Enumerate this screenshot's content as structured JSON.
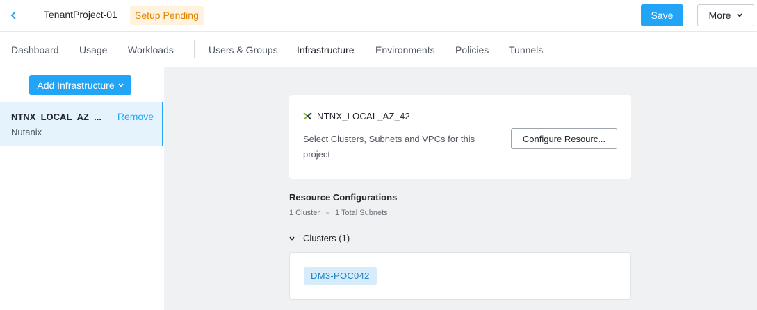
{
  "header": {
    "project_name": "TenantProject-01",
    "status_badge": "Setup Pending",
    "save_label": "Save",
    "more_label": "More"
  },
  "tabs": [
    {
      "label": "Dashboard",
      "active": false
    },
    {
      "label": "Usage",
      "active": false
    },
    {
      "label": "Workloads",
      "active": false
    },
    {
      "label": "Users & Groups",
      "active": false
    },
    {
      "label": "Infrastructure",
      "active": true
    },
    {
      "label": "Environments",
      "active": false
    },
    {
      "label": "Policies",
      "active": false
    },
    {
      "label": "Tunnels",
      "active": false
    }
  ],
  "sidebar": {
    "add_button_label": "Add Infrastructure",
    "items": [
      {
        "name": "NTNX_LOCAL_AZ_...",
        "remove_label": "Remove",
        "type": "Nutanix"
      }
    ]
  },
  "main": {
    "account_card": {
      "icon": "nutanix-logo-icon",
      "title": "NTNX_LOCAL_AZ_42",
      "description": "Select Clusters, Subnets and VPCs for this project",
      "configure_label": "Configure Resourc..."
    },
    "resource_configurations": {
      "title": "Resource Configurations",
      "cluster_count": "1 Cluster",
      "subnet_count": "1 Total Subnets",
      "clusters_section_label": "Clusters (1)",
      "clusters": [
        "DM3-POC042"
      ]
    }
  },
  "colors": {
    "accent": "#22a5f7",
    "badge_bg": "#fff3df",
    "badge_text": "#e08600",
    "nutanix_green": "#7ab829",
    "chip_bg": "#d6ecfb"
  }
}
